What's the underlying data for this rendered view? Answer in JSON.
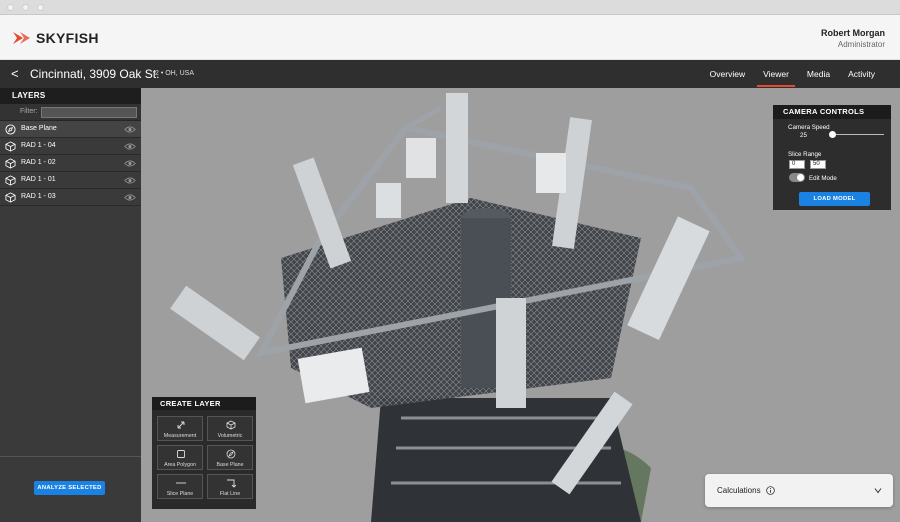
{
  "brand": {
    "name": "SKYFISH",
    "accent": "#e14b32"
  },
  "user": {
    "name": "Robert Morgan",
    "role": "Administrator"
  },
  "location": {
    "back_glyph": "<",
    "title": "Cincinnati, 3909 Oak St.",
    "subtitle": "2 • OH, USA"
  },
  "tabs": [
    {
      "label": "Overview",
      "active": false
    },
    {
      "label": "Viewer",
      "active": true
    },
    {
      "label": "Media",
      "active": false
    },
    {
      "label": "Activity",
      "active": false
    }
  ],
  "layers": {
    "header": "LAYERS",
    "filter_label": "Filter:",
    "filter_value": "",
    "items": [
      {
        "label": "Base Plane",
        "icon": "compass-icon"
      },
      {
        "label": "RAD 1 - 04",
        "icon": "cube-icon"
      },
      {
        "label": "RAD 1 - 02",
        "icon": "cube-icon"
      },
      {
        "label": "RAD 1 - 01",
        "icon": "cube-icon"
      },
      {
        "label": "RAD 1 - 03",
        "icon": "cube-icon"
      }
    ],
    "analyze_label": "ANALYZE SELECTED"
  },
  "camera": {
    "header": "CAMERA CONTROLS",
    "speed_label": "Camera Speed",
    "speed_value": "25",
    "slice_label": "Slice Range",
    "slice_min": "0",
    "slice_max": "50",
    "edit_mode_label": "Edit Mode",
    "load_label": "LOAD MODEL"
  },
  "create_layer": {
    "header": "CREATE LAYER",
    "tools": [
      {
        "label": "Measurement",
        "icon": "measure-arrow-icon"
      },
      {
        "label": "Volumetric",
        "icon": "cube-icon"
      },
      {
        "label": "Area Polygon",
        "icon": "square-icon"
      },
      {
        "label": "Base Plane",
        "icon": "compass-icon"
      },
      {
        "label": "Slice Plane",
        "icon": "line-icon"
      },
      {
        "label": "Flat Line",
        "icon": "corner-arrow-icon"
      }
    ]
  },
  "calculations": {
    "label": "Calculations"
  },
  "colors": {
    "button_blue": "#1a82e2",
    "panel_dark": "#2d2d2d",
    "sidebar": "#3a3a3a"
  }
}
